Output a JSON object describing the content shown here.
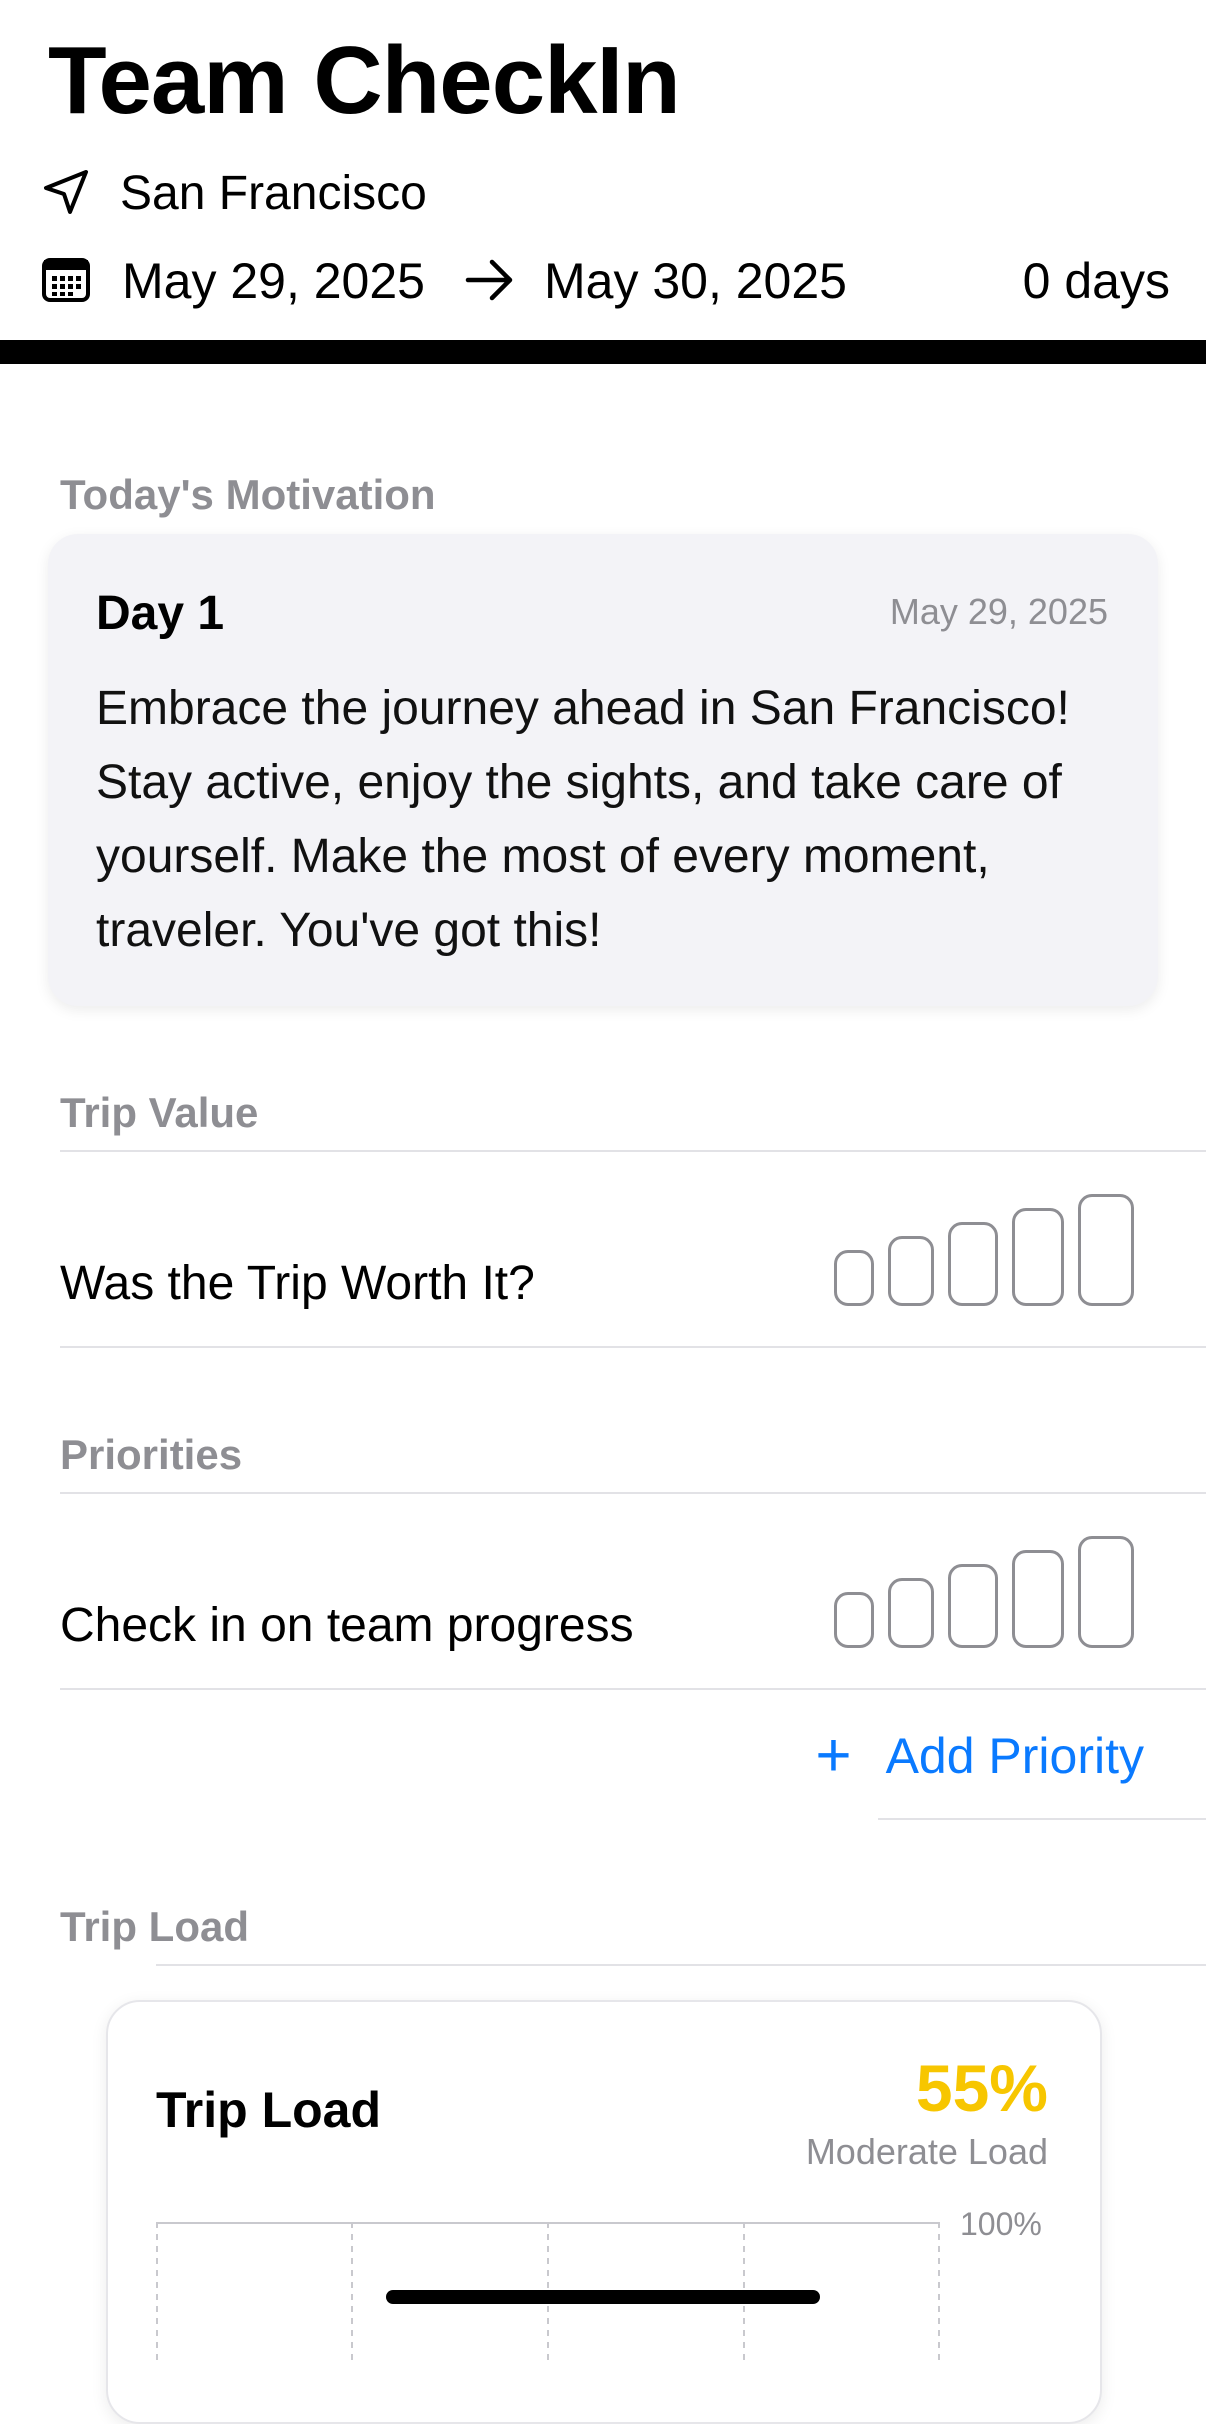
{
  "header": {
    "title": "Team CheckIn",
    "location": "San Francisco",
    "date_start": "May 29, 2025",
    "date_end": "May 30, 2025",
    "duration": "0 days",
    "icons": {
      "location": "location-arrow-icon",
      "calendar": "calendar-icon",
      "arrow": "arrow-right-icon"
    }
  },
  "motivation": {
    "section_label": "Today's Motivation",
    "day": "Day 1",
    "date": "May 29, 2025",
    "text": "Embrace the journey ahead in San Francisco! Stay active, enjoy the sights, and take care of yourself. Make the most of every moment, traveler. You've got this!"
  },
  "trip_value": {
    "section_label": "Trip Value",
    "question": "Was the Trip Worth It?",
    "rating": {
      "selected": 0,
      "max": 5
    }
  },
  "priorities": {
    "section_label": "Priorities",
    "items": [
      {
        "label": "Check in on team progress",
        "rating": {
          "selected": 0,
          "max": 5
        }
      }
    ],
    "add_label": "Add Priority"
  },
  "trip_load": {
    "section_label": "Trip Load",
    "title": "Trip Load",
    "percent": "55%",
    "level": "Moderate Load",
    "axis_max_label": "100%"
  },
  "colors": {
    "accent_blue": "#0a7aff",
    "load_yellow": "#f7c600",
    "secondary_gray": "#8e8e93"
  }
}
